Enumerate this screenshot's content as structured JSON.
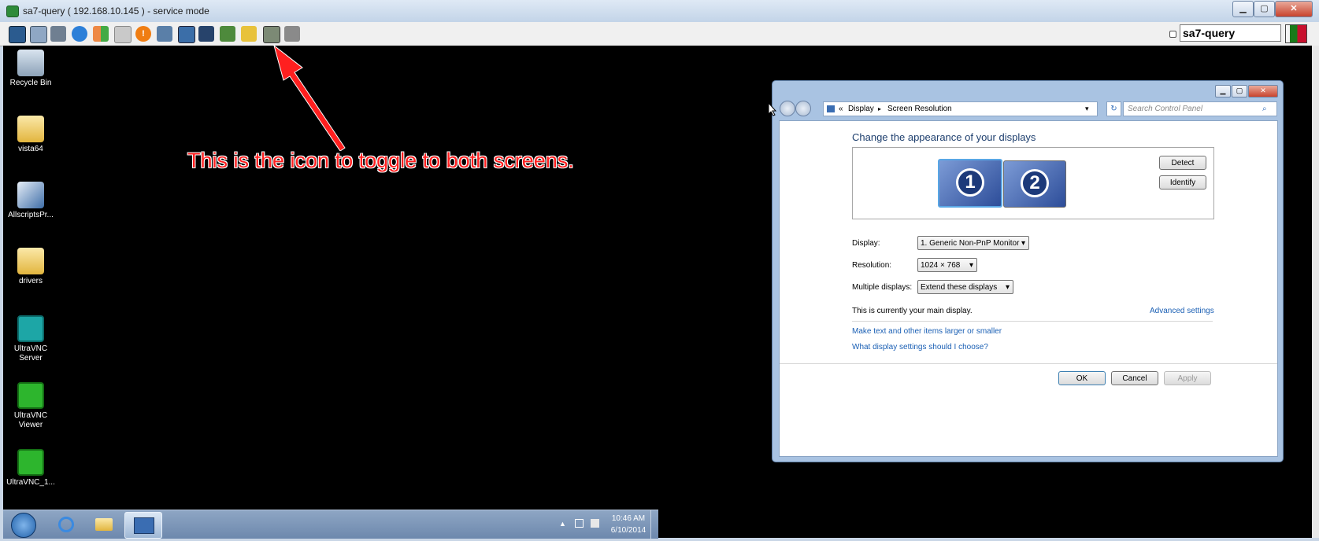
{
  "window": {
    "title": "sa7-query ( 192.168.10.145 ) - service mode",
    "minimize_label": "▁",
    "maximize_label": "▢",
    "close_label": "✕"
  },
  "toolbar": {
    "session_name": "sa7-query"
  },
  "desktop": {
    "icons": [
      {
        "label": "Recycle Bin"
      },
      {
        "label": "vista64"
      },
      {
        "label": "AllscriptsPr..."
      },
      {
        "label": "drivers"
      },
      {
        "label": "UltraVNC Server"
      },
      {
        "label": "UltraVNC Viewer"
      },
      {
        "label": "UltraVNC_1..."
      }
    ]
  },
  "annotation": {
    "text": "This is the icon to toggle to both screens."
  },
  "control_panel": {
    "breadcrumb_back": "«",
    "breadcrumb_1": "Display",
    "breadcrumb_sep": "▸",
    "breadcrumb_2": "Screen Resolution",
    "search_placeholder": "Search Control Panel",
    "heading": "Change the appearance of your displays",
    "detect_label": "Detect",
    "identify_label": "Identify",
    "monitor_1": "1",
    "monitor_2": "2",
    "display_label": "Display:",
    "display_value": "1. Generic Non-PnP Monitor",
    "resolution_label": "Resolution:",
    "resolution_value": "1024 × 768",
    "multiple_label": "Multiple displays:",
    "multiple_value": "Extend these displays",
    "main_display_text": "This is currently your main display.",
    "advanced_link": "Advanced settings",
    "link_text_size": "Make text and other items larger or smaller",
    "link_which_settings": "What display settings should I choose?",
    "ok_label": "OK",
    "cancel_label": "Cancel",
    "apply_label": "Apply"
  },
  "taskbar": {
    "time": "10:46 AM",
    "date": "6/10/2014"
  },
  "colors": {
    "annotation": "#ff1f1f",
    "link": "#1a5fb4",
    "desktop": "#000000"
  }
}
